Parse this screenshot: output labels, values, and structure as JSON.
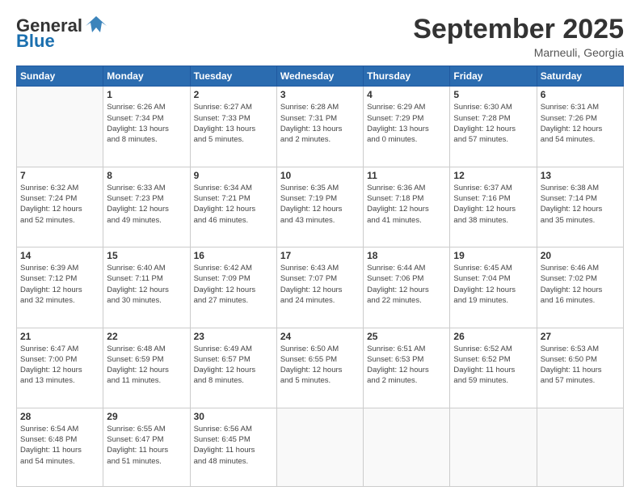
{
  "header": {
    "logo_general": "General",
    "logo_blue": "Blue",
    "month_title": "September 2025",
    "subtitle": "Marneuli, Georgia"
  },
  "calendar": {
    "days_of_week": [
      "Sunday",
      "Monday",
      "Tuesday",
      "Wednesday",
      "Thursday",
      "Friday",
      "Saturday"
    ],
    "weeks": [
      [
        {
          "day": "",
          "info": ""
        },
        {
          "day": "1",
          "info": "Sunrise: 6:26 AM\nSunset: 7:34 PM\nDaylight: 13 hours\nand 8 minutes."
        },
        {
          "day": "2",
          "info": "Sunrise: 6:27 AM\nSunset: 7:33 PM\nDaylight: 13 hours\nand 5 minutes."
        },
        {
          "day": "3",
          "info": "Sunrise: 6:28 AM\nSunset: 7:31 PM\nDaylight: 13 hours\nand 2 minutes."
        },
        {
          "day": "4",
          "info": "Sunrise: 6:29 AM\nSunset: 7:29 PM\nDaylight: 13 hours\nand 0 minutes."
        },
        {
          "day": "5",
          "info": "Sunrise: 6:30 AM\nSunset: 7:28 PM\nDaylight: 12 hours\nand 57 minutes."
        },
        {
          "day": "6",
          "info": "Sunrise: 6:31 AM\nSunset: 7:26 PM\nDaylight: 12 hours\nand 54 minutes."
        }
      ],
      [
        {
          "day": "7",
          "info": "Sunrise: 6:32 AM\nSunset: 7:24 PM\nDaylight: 12 hours\nand 52 minutes."
        },
        {
          "day": "8",
          "info": "Sunrise: 6:33 AM\nSunset: 7:23 PM\nDaylight: 12 hours\nand 49 minutes."
        },
        {
          "day": "9",
          "info": "Sunrise: 6:34 AM\nSunset: 7:21 PM\nDaylight: 12 hours\nand 46 minutes."
        },
        {
          "day": "10",
          "info": "Sunrise: 6:35 AM\nSunset: 7:19 PM\nDaylight: 12 hours\nand 43 minutes."
        },
        {
          "day": "11",
          "info": "Sunrise: 6:36 AM\nSunset: 7:18 PM\nDaylight: 12 hours\nand 41 minutes."
        },
        {
          "day": "12",
          "info": "Sunrise: 6:37 AM\nSunset: 7:16 PM\nDaylight: 12 hours\nand 38 minutes."
        },
        {
          "day": "13",
          "info": "Sunrise: 6:38 AM\nSunset: 7:14 PM\nDaylight: 12 hours\nand 35 minutes."
        }
      ],
      [
        {
          "day": "14",
          "info": "Sunrise: 6:39 AM\nSunset: 7:12 PM\nDaylight: 12 hours\nand 32 minutes."
        },
        {
          "day": "15",
          "info": "Sunrise: 6:40 AM\nSunset: 7:11 PM\nDaylight: 12 hours\nand 30 minutes."
        },
        {
          "day": "16",
          "info": "Sunrise: 6:42 AM\nSunset: 7:09 PM\nDaylight: 12 hours\nand 27 minutes."
        },
        {
          "day": "17",
          "info": "Sunrise: 6:43 AM\nSunset: 7:07 PM\nDaylight: 12 hours\nand 24 minutes."
        },
        {
          "day": "18",
          "info": "Sunrise: 6:44 AM\nSunset: 7:06 PM\nDaylight: 12 hours\nand 22 minutes."
        },
        {
          "day": "19",
          "info": "Sunrise: 6:45 AM\nSunset: 7:04 PM\nDaylight: 12 hours\nand 19 minutes."
        },
        {
          "day": "20",
          "info": "Sunrise: 6:46 AM\nSunset: 7:02 PM\nDaylight: 12 hours\nand 16 minutes."
        }
      ],
      [
        {
          "day": "21",
          "info": "Sunrise: 6:47 AM\nSunset: 7:00 PM\nDaylight: 12 hours\nand 13 minutes."
        },
        {
          "day": "22",
          "info": "Sunrise: 6:48 AM\nSunset: 6:59 PM\nDaylight: 12 hours\nand 11 minutes."
        },
        {
          "day": "23",
          "info": "Sunrise: 6:49 AM\nSunset: 6:57 PM\nDaylight: 12 hours\nand 8 minutes."
        },
        {
          "day": "24",
          "info": "Sunrise: 6:50 AM\nSunset: 6:55 PM\nDaylight: 12 hours\nand 5 minutes."
        },
        {
          "day": "25",
          "info": "Sunrise: 6:51 AM\nSunset: 6:53 PM\nDaylight: 12 hours\nand 2 minutes."
        },
        {
          "day": "26",
          "info": "Sunrise: 6:52 AM\nSunset: 6:52 PM\nDaylight: 11 hours\nand 59 minutes."
        },
        {
          "day": "27",
          "info": "Sunrise: 6:53 AM\nSunset: 6:50 PM\nDaylight: 11 hours\nand 57 minutes."
        }
      ],
      [
        {
          "day": "28",
          "info": "Sunrise: 6:54 AM\nSunset: 6:48 PM\nDaylight: 11 hours\nand 54 minutes."
        },
        {
          "day": "29",
          "info": "Sunrise: 6:55 AM\nSunset: 6:47 PM\nDaylight: 11 hours\nand 51 minutes."
        },
        {
          "day": "30",
          "info": "Sunrise: 6:56 AM\nSunset: 6:45 PM\nDaylight: 11 hours\nand 48 minutes."
        },
        {
          "day": "",
          "info": ""
        },
        {
          "day": "",
          "info": ""
        },
        {
          "day": "",
          "info": ""
        },
        {
          "day": "",
          "info": ""
        }
      ]
    ]
  }
}
